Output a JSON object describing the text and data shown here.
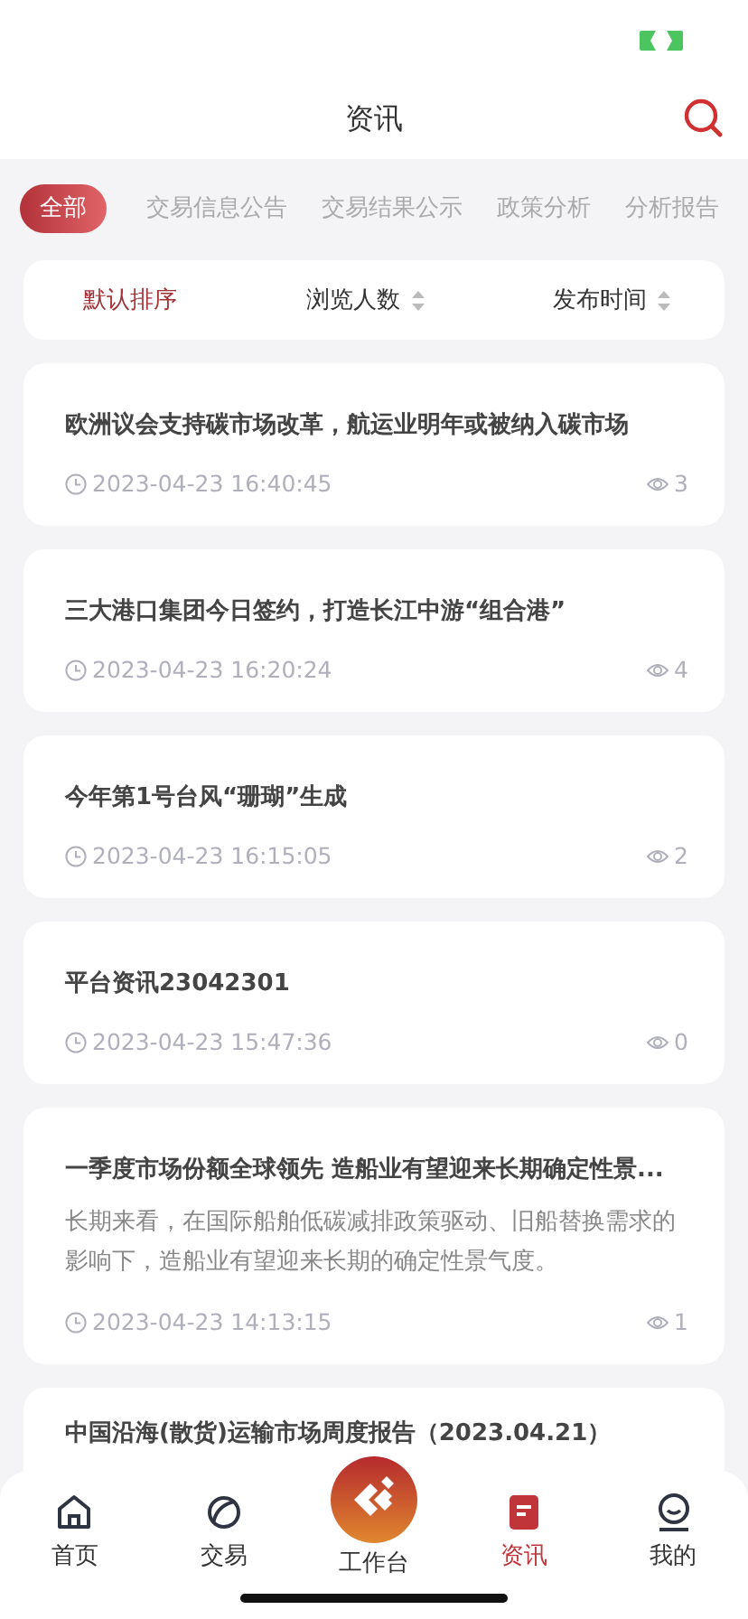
{
  "header": {
    "title": "资讯"
  },
  "tabs": [
    {
      "label": "全部",
      "selected": true
    },
    {
      "label": "交易信息公告",
      "selected": false
    },
    {
      "label": "交易结果公示",
      "selected": false
    },
    {
      "label": "政策分析",
      "selected": false
    },
    {
      "label": "分析报告",
      "selected": false
    }
  ],
  "sort_options": [
    {
      "label": "默认排序",
      "selected": true,
      "sortable": false
    },
    {
      "label": "浏览人数",
      "selected": false,
      "sortable": true
    },
    {
      "label": "发布时间",
      "selected": false,
      "sortable": true
    }
  ],
  "articles": [
    {
      "title": "欧洲议会支持碳市场改革，航运业明年或被纳入碳市场",
      "time": "2023-04-23 16:40:45",
      "views": "3"
    },
    {
      "title": "三大港口集团今日签约，打造长江中游“组合港”",
      "time": "2023-04-23 16:20:24",
      "views": "4"
    },
    {
      "title": "今年第1号台风“珊瑚”生成",
      "time": "2023-04-23 16:15:05",
      "views": "2"
    },
    {
      "title": "平台资讯23042301",
      "time": "2023-04-23 15:47:36",
      "views": "0"
    },
    {
      "title": "一季度市场份额全球领先 造船业有望迎来长期确定性景...",
      "summary": "长期来看，在国际船舶低碳减排政策驱动、旧船替换需求的影响下，造船业有望迎来长期的确定性景气度。",
      "time": "2023-04-23 14:13:15",
      "views": "1"
    },
    {
      "title": "中国沿海(散货)运输市场周度报告（2023.04.21）"
    }
  ],
  "bottom_nav": [
    {
      "label": "首页",
      "kind": "home",
      "selected": false
    },
    {
      "label": "交易",
      "kind": "trade",
      "selected": false
    },
    {
      "label": "工作台",
      "kind": "center",
      "selected": false
    },
    {
      "label": "资讯",
      "kind": "news",
      "selected": true
    },
    {
      "label": "我的",
      "kind": "profile",
      "selected": false
    }
  ]
}
